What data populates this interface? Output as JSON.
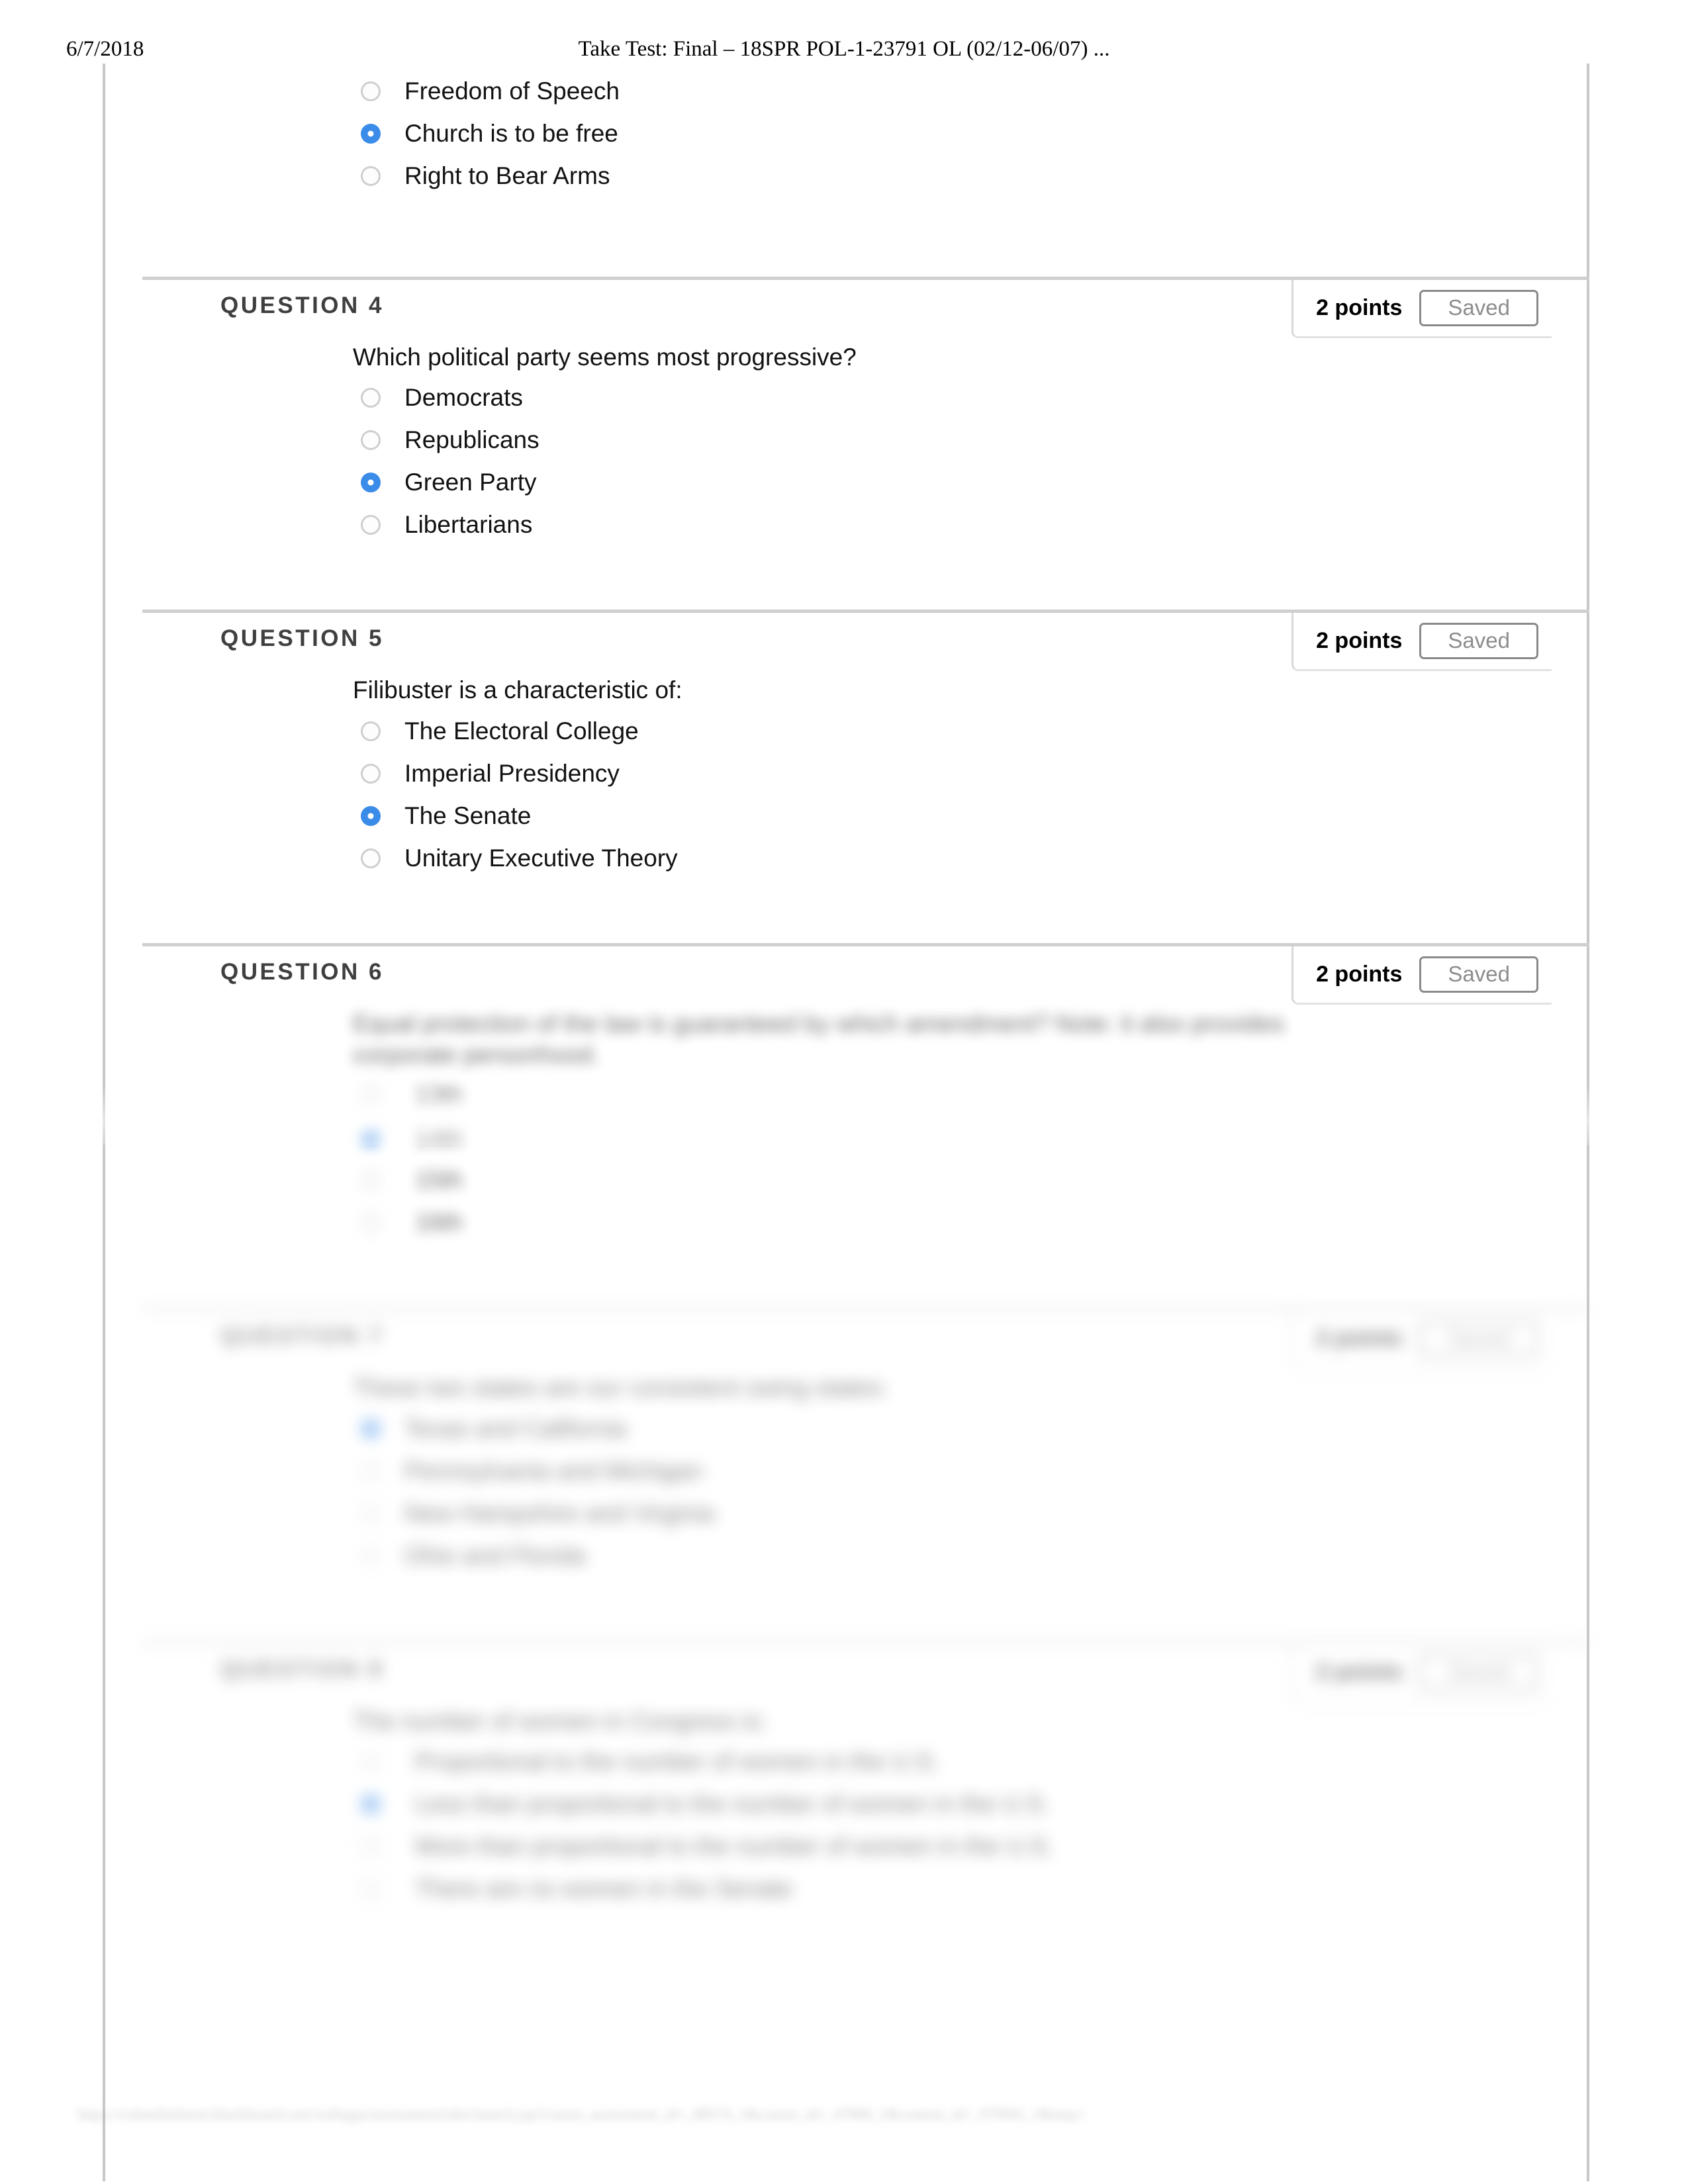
{
  "print_header": {
    "date": "6/7/2018",
    "title": "Take Test: Final – 18SPR POL-1-23791 OL (02/12-06/07) ..."
  },
  "colors": {
    "radio_selected": "#3b8ce8",
    "radio_border": "#cfcfcf",
    "question_heading": "#3f3f3f",
    "rule": "#cfcfcf",
    "saved_text": "#8d8d8d",
    "page_border": "#c8c8c8"
  },
  "labels": {
    "points_suffix": "points",
    "saved": "Saved"
  },
  "previous_question_options": [
    {
      "label": "Freedom of Speech",
      "selected": false
    },
    {
      "label": "Church is to be free",
      "selected": true
    },
    {
      "label": "Right to Bear Arms",
      "selected": false
    }
  ],
  "questions": [
    {
      "heading": "QUESTION 4",
      "points": "2 points",
      "status": "Saved",
      "text": "Which political party seems most progressive?",
      "options": [
        {
          "label": "Democrats",
          "selected": false
        },
        {
          "label": "Republicans",
          "selected": false
        },
        {
          "label": "Green Party",
          "selected": true
        },
        {
          "label": "Libertarians",
          "selected": false
        }
      ]
    },
    {
      "heading": "QUESTION 5",
      "points": "2 points",
      "status": "Saved",
      "text": "Filibuster is a characteristic of:",
      "options": [
        {
          "label": "The Electoral College",
          "selected": false
        },
        {
          "label": "Imperial Presidency",
          "selected": false
        },
        {
          "label": "The Senate",
          "selected": true
        },
        {
          "label": "Unitary Executive Theory",
          "selected": false
        }
      ]
    },
    {
      "heading": "QUESTION 6",
      "points": "2 points",
      "status": "Saved",
      "text": "Equal protection of the law is guaranteed by which amendment? Note: it also provides corporate personhood.",
      "options": [
        {
          "label": "13th",
          "selected": false
        },
        {
          "label": "14th",
          "selected": true
        },
        {
          "label": "15th",
          "selected": false
        },
        {
          "label": "16th",
          "selected": false
        }
      ]
    },
    {
      "heading": "QUESTION 7",
      "points": "2 points",
      "status": "Saved",
      "text": "These two states are our consistent swing states:",
      "options": [
        {
          "label": "Texas and California",
          "selected": true
        },
        {
          "label": "Pennsylvania and Michigan",
          "selected": false
        },
        {
          "label": "New Hampshire and Virginia",
          "selected": false
        },
        {
          "label": "Ohio and Florida",
          "selected": false
        }
      ]
    },
    {
      "heading": "QUESTION 8",
      "points": "2 points",
      "status": "Saved",
      "text": "The number of women in Congress is:",
      "options": [
        {
          "label": "Proportional to the number of women in the U.S.",
          "selected": false
        },
        {
          "label": "Less than proportional to the number of women in the U.S.",
          "selected": true
        },
        {
          "label": "More than proportional to the number of women in the U.S.",
          "selected": false
        },
        {
          "label": "There are no women in the Senate",
          "selected": false
        }
      ]
    }
  ],
  "footer": {
    "url": "https://columbiabasin.blackboard.com/webapps/assessment/take/launch.jsp?course_assessment_id=_88574_1&course_id=_47860_1&content_id=_970941_1&step="
  }
}
